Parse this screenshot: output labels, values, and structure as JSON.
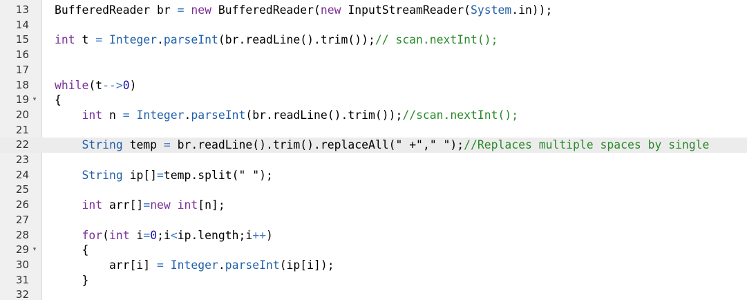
{
  "editor": {
    "lines": [
      {
        "num": "13",
        "fold": "",
        "active": false,
        "tokens": [
          {
            "t": "BufferedReader br ",
            "c": ""
          },
          {
            "t": "=",
            "c": "op"
          },
          {
            "t": " ",
            "c": ""
          },
          {
            "t": "new",
            "c": "kw"
          },
          {
            "t": " BufferedReader(",
            "c": ""
          },
          {
            "t": "new",
            "c": "kw"
          },
          {
            "t": " InputStreamReader(",
            "c": ""
          },
          {
            "t": "System",
            "c": "ty"
          },
          {
            "t": ".in));",
            "c": ""
          }
        ]
      },
      {
        "num": "14",
        "fold": "",
        "active": false,
        "tokens": []
      },
      {
        "num": "15",
        "fold": "",
        "active": false,
        "tokens": [
          {
            "t": "int",
            "c": "kw"
          },
          {
            "t": " t ",
            "c": ""
          },
          {
            "t": "=",
            "c": "op"
          },
          {
            "t": " ",
            "c": ""
          },
          {
            "t": "Integer",
            "c": "ty"
          },
          {
            "t": ".",
            "c": ""
          },
          {
            "t": "parseInt",
            "c": "ty"
          },
          {
            "t": "(br.readLine().trim());",
            "c": ""
          },
          {
            "t": "// scan.nextInt();",
            "c": "cm"
          }
        ]
      },
      {
        "num": "16",
        "fold": "",
        "active": false,
        "tokens": []
      },
      {
        "num": "17",
        "fold": "",
        "active": false,
        "tokens": []
      },
      {
        "num": "18",
        "fold": "",
        "active": false,
        "tokens": [
          {
            "t": "while",
            "c": "kw"
          },
          {
            "t": "(t",
            "c": ""
          },
          {
            "t": "-->",
            "c": "op"
          },
          {
            "t": "0",
            "c": "num"
          },
          {
            "t": ")",
            "c": ""
          }
        ]
      },
      {
        "num": "19",
        "fold": "▾",
        "active": false,
        "tokens": [
          {
            "t": "{",
            "c": ""
          }
        ]
      },
      {
        "num": "20",
        "fold": "",
        "active": false,
        "tokens": [
          {
            "t": "    ",
            "c": ""
          },
          {
            "t": "int",
            "c": "kw"
          },
          {
            "t": " n ",
            "c": ""
          },
          {
            "t": "=",
            "c": "op"
          },
          {
            "t": " ",
            "c": ""
          },
          {
            "t": "Integer",
            "c": "ty"
          },
          {
            "t": ".",
            "c": ""
          },
          {
            "t": "parseInt",
            "c": "ty"
          },
          {
            "t": "(br.readLine().trim());",
            "c": ""
          },
          {
            "t": "//scan.nextInt();",
            "c": "cm"
          }
        ]
      },
      {
        "num": "21",
        "fold": "",
        "active": false,
        "tokens": []
      },
      {
        "num": "22",
        "fold": "",
        "active": true,
        "tokens": [
          {
            "t": "    ",
            "c": ""
          },
          {
            "t": "String",
            "c": "ty"
          },
          {
            "t": " temp ",
            "c": ""
          },
          {
            "t": "=",
            "c": "op"
          },
          {
            "t": " br.readLine().trim().replaceAll(",
            "c": ""
          },
          {
            "t": "\" +\"",
            "c": "str"
          },
          {
            "t": ",",
            "c": ""
          },
          {
            "t": "\" \"",
            "c": "str"
          },
          {
            "t": ");",
            "c": ""
          },
          {
            "t": "//Replaces multiple spaces by single",
            "c": "cm"
          }
        ]
      },
      {
        "num": "23",
        "fold": "",
        "active": false,
        "tokens": []
      },
      {
        "num": "24",
        "fold": "",
        "active": false,
        "tokens": [
          {
            "t": "    ",
            "c": ""
          },
          {
            "t": "String",
            "c": "ty"
          },
          {
            "t": " ip[]",
            "c": ""
          },
          {
            "t": "=",
            "c": "op"
          },
          {
            "t": "temp.split(",
            "c": ""
          },
          {
            "t": "\" \"",
            "c": "str"
          },
          {
            "t": ");",
            "c": ""
          }
        ]
      },
      {
        "num": "25",
        "fold": "",
        "active": false,
        "tokens": []
      },
      {
        "num": "26",
        "fold": "",
        "active": false,
        "tokens": [
          {
            "t": "    ",
            "c": ""
          },
          {
            "t": "int",
            "c": "kw"
          },
          {
            "t": " arr[]",
            "c": ""
          },
          {
            "t": "=",
            "c": "op"
          },
          {
            "t": "new",
            "c": "kw"
          },
          {
            "t": " ",
            "c": ""
          },
          {
            "t": "int",
            "c": "kw"
          },
          {
            "t": "[n];",
            "c": ""
          }
        ]
      },
      {
        "num": "27",
        "fold": "",
        "active": false,
        "tokens": []
      },
      {
        "num": "28",
        "fold": "",
        "active": false,
        "tokens": [
          {
            "t": "    ",
            "c": ""
          },
          {
            "t": "for",
            "c": "kw"
          },
          {
            "t": "(",
            "c": ""
          },
          {
            "t": "int",
            "c": "kw"
          },
          {
            "t": " i",
            "c": ""
          },
          {
            "t": "=",
            "c": "op"
          },
          {
            "t": "0",
            "c": "num"
          },
          {
            "t": ";i",
            "c": ""
          },
          {
            "t": "<",
            "c": "op"
          },
          {
            "t": "ip.length;i",
            "c": ""
          },
          {
            "t": "++",
            "c": "op"
          },
          {
            "t": ")",
            "c": ""
          }
        ]
      },
      {
        "num": "29",
        "fold": "▾",
        "active": false,
        "tokens": [
          {
            "t": "    {",
            "c": ""
          }
        ]
      },
      {
        "num": "30",
        "fold": "",
        "active": false,
        "tokens": [
          {
            "t": "        arr[i] ",
            "c": ""
          },
          {
            "t": "=",
            "c": "op"
          },
          {
            "t": " ",
            "c": ""
          },
          {
            "t": "Integer",
            "c": "ty"
          },
          {
            "t": ".",
            "c": ""
          },
          {
            "t": "parseInt",
            "c": "ty"
          },
          {
            "t": "(ip[i]);",
            "c": ""
          }
        ]
      },
      {
        "num": "31",
        "fold": "",
        "active": false,
        "tokens": [
          {
            "t": "    }",
            "c": ""
          }
        ]
      },
      {
        "num": "32",
        "fold": "",
        "active": false,
        "tokens": []
      }
    ]
  }
}
